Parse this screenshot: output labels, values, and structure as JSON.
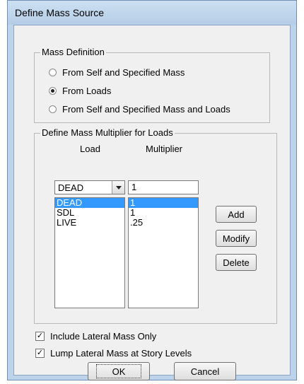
{
  "window": {
    "title": "Define Mass Source"
  },
  "mass_definition": {
    "group_label": "Mass Definition",
    "options": [
      "From Self and Specified Mass",
      "From Loads",
      "From Self and Specified Mass and Loads"
    ],
    "selected_index": 1
  },
  "multiplier": {
    "group_label": "Define Mass Multiplier for Loads",
    "load_header": "Load",
    "multiplier_header": "Multiplier",
    "load_combo_value": "DEAD",
    "multiplier_value": "1",
    "rows": [
      {
        "load": "DEAD",
        "multiplier": "1",
        "selected": true
      },
      {
        "load": "SDL",
        "multiplier": "1",
        "selected": false
      },
      {
        "load": "LIVE",
        "multiplier": ".25",
        "selected": false
      }
    ]
  },
  "buttons": {
    "add": "Add",
    "modify": "Modify",
    "delete": "Delete",
    "ok": "OK",
    "cancel": "Cancel"
  },
  "options": {
    "include_lateral_mass_only": {
      "label": "Include Lateral Mass Only",
      "checked": true
    },
    "lump_lateral_mass": {
      "label": "Lump Lateral Mass at Story Levels",
      "checked": true
    }
  },
  "icons": {
    "combo_arrow": "chevron-down-icon",
    "check": "check-icon"
  }
}
